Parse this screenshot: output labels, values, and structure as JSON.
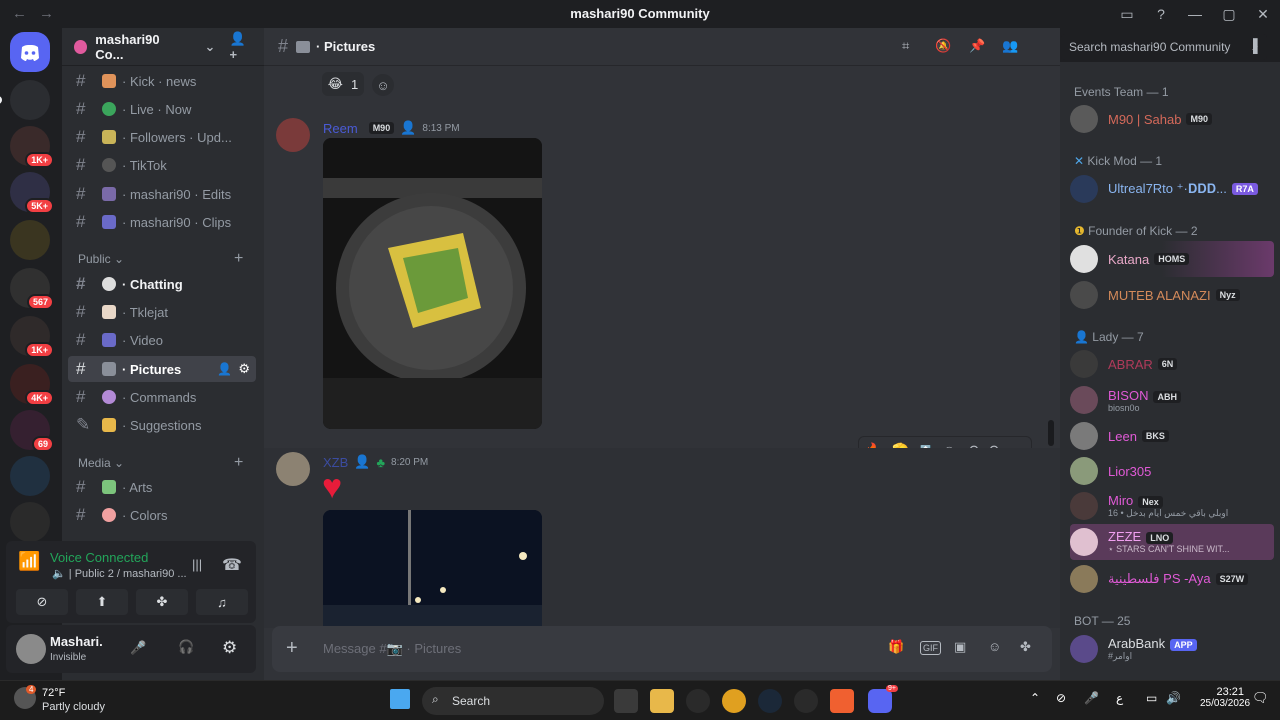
{
  "window": {
    "title": "mashari90 Community"
  },
  "server": {
    "name": "mashari90 Co..."
  },
  "channels": [
    {
      "name": "· Kick · news"
    },
    {
      "name": "· Live · Now"
    },
    {
      "name": "· Followers · Upd..."
    },
    {
      "name": "· TikTok"
    },
    {
      "name": "· mashari90 · Edits"
    },
    {
      "name": "· mashari90 · Clips"
    },
    {
      "category": "Public"
    },
    {
      "name": "· Chatting"
    },
    {
      "name": "· Tklejat"
    },
    {
      "name": "· Video"
    },
    {
      "name": "· Pictures"
    },
    {
      "name": "· Commands"
    },
    {
      "name": "· Suggestions"
    },
    {
      "category": "Media"
    },
    {
      "name": "· Arts"
    },
    {
      "name": "· Colors"
    }
  ],
  "server_badges": [
    "1K+",
    "5K+",
    "567",
    "1K+",
    "4K+",
    "69"
  ],
  "voice": {
    "status": "Voice Connected",
    "channel": "Public 2 / mashari90 ..."
  },
  "user": {
    "name": "Mashari.",
    "status": "Invisible"
  },
  "main": {
    "channel_title": "· Pictures",
    "reaction_count": "1",
    "msg1": {
      "author": "Reem",
      "tag": "M90",
      "time": "8:13 PM"
    },
    "msg2": {
      "author": "XZB",
      "time": "8:20 PM"
    },
    "composer_placeholder": "Message #📷 · Pictures",
    "search_placeholder": "Search mashari90 Community"
  },
  "members": {
    "events": {
      "title": "Events Team — 1",
      "list": [
        {
          "name": "M90 | Sahab",
          "tag": "M90"
        }
      ]
    },
    "kickmod": {
      "title": "Kick Mod — 1",
      "list": [
        {
          "name": "Ultreal7Rto ⁺·𝐃𝐃𝐃...",
          "tag": "R7A"
        }
      ]
    },
    "founder": {
      "title": "Founder of Kick — 2",
      "list": [
        {
          "name": "Katana",
          "tag": "HOMS"
        },
        {
          "name": "MUTEB ALANAZI",
          "tag": "Nyz"
        }
      ]
    },
    "lady": {
      "title": "Lady — 7",
      "list": [
        {
          "name": "ABRAR",
          "tag": "6N"
        },
        {
          "name": "BISON",
          "tag": "ABH",
          "sub": "biosn0o"
        },
        {
          "name": "Leen",
          "tag": "BKS"
        },
        {
          "name": "Lior305"
        },
        {
          "name": "Miro",
          "tag": "Nex",
          "sub": "16 • اوبلي باقي خمس ايام بدخل"
        },
        {
          "name": "ZEZE",
          "tag": "LNO",
          "sub": "⋆ STARS CAN'T SHINE WIT..."
        },
        {
          "name": "فلسطينية PS -Aya",
          "tag": "S27W"
        }
      ]
    },
    "bot": {
      "title": "BOT — 25",
      "list": [
        {
          "name": "ArabBank",
          "tag": "APP",
          "sub": "#اوامر"
        }
      ]
    }
  },
  "taskbar": {
    "weather_temp": "72°F",
    "weather_desc": "Partly cloudy",
    "search": "Search",
    "time": "23:21",
    "date": "25/03/2026",
    "notif": "4",
    "discord_badge": "9+"
  }
}
